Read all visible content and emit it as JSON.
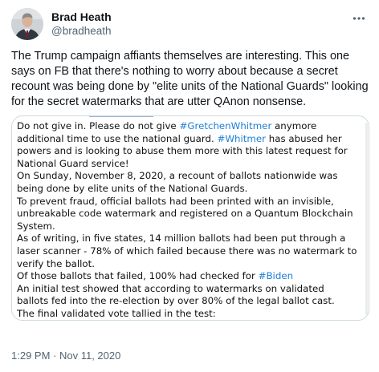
{
  "author": {
    "display_name": "Brad Heath",
    "handle": "@bradheath",
    "avatar_icon": "profile-photo"
  },
  "more_icon": "more-horizontal-icon",
  "tweet_text": "The Trump campaign affiants themselves are interesting. This one says on FB that there's nothing to worry about because a secret recount was being done by \"elite units of the National Guards\" looking for the secret watermarks that are utter QAnon nonsense.",
  "media": {
    "lines": [
      [
        {
          "t": "Do not give in. Please do not give "
        },
        {
          "t": "#GretchenWhitmer",
          "tag": true
        },
        {
          "t": " anymore"
        }
      ],
      [
        {
          "t": "additional time to use the national guard. "
        },
        {
          "t": "#Whitmer",
          "tag": true
        },
        {
          "t": " has abused her"
        }
      ],
      [
        {
          "t": "powers and is looking to abuse them more with this latest request for"
        }
      ],
      [
        {
          "t": "National Guard service!"
        }
      ],
      [
        {
          "t": "On Sunday, November 8, 2020, a recount of ballots nationwide was"
        }
      ],
      [
        {
          "t": "being done by elite units of the National Guards."
        }
      ],
      [
        {
          "t": "To prevent fraud, official ballots had been printed with an invisible,"
        }
      ],
      [
        {
          "t": "unbreakable code watermark and registered on a Quantum Blockchain"
        }
      ],
      [
        {
          "t": "System."
        }
      ],
      [
        {
          "t": "As of writing, in five states, 14 million ballots had been put through a"
        }
      ],
      [
        {
          "t": "laser scanner - 78% of which failed because there was no watermark to"
        }
      ],
      [
        {
          "t": "verify the ballot."
        }
      ],
      [
        {
          "t": "Of those ballots that failed, 100% had checked for "
        },
        {
          "t": "#Biden",
          "tag": true
        }
      ],
      [
        {
          "t": "An initial test showed that according to watermarks on validated"
        }
      ],
      [
        {
          "t": "ballots fed into the re-election by over 80% of the legal ballot cast."
        }
      ],
      [
        {
          "t": "The final validated vote tallied in the test:"
        }
      ]
    ]
  },
  "timestamp": "1:29 PM · Nov 11, 2020",
  "colors": {
    "text": "#0f1419",
    "secondary": "#536471",
    "hashtag": "#1d7ed8",
    "border": "#cfd9de"
  }
}
